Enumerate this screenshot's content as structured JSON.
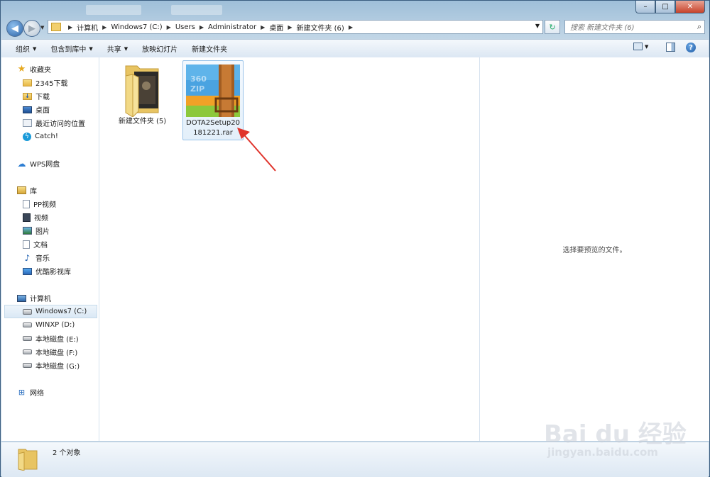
{
  "window": {
    "controls": {
      "minimize": "–",
      "maximize": "□",
      "close": "✕"
    }
  },
  "address": {
    "crumbs": [
      "计算机",
      "Windows7 (C:)",
      "Users",
      "Administrator",
      "桌面",
      "新建文件夹 (6)"
    ],
    "search_placeholder": "搜索 新建文件夹 (6)"
  },
  "toolbar": {
    "organize": "组织",
    "include_library": "包含到库中",
    "share": "共享",
    "slideshow": "放映幻灯片",
    "new_folder": "新建文件夹"
  },
  "sidebar": {
    "favorites": {
      "label": "收藏夹",
      "items": [
        "2345下载",
        "下载",
        "桌面",
        "最近访问的位置",
        "Catch!"
      ]
    },
    "wps": {
      "label": "WPS网盘"
    },
    "libraries": {
      "label": "库",
      "items": [
        "PP视频",
        "视频",
        "图片",
        "文档",
        "音乐",
        "优酷影视库"
      ]
    },
    "computer": {
      "label": "计算机",
      "items": [
        "Windows7 (C:)",
        "WINXP (D:)",
        "本地磁盘 (E:)",
        "本地磁盘 (F:)",
        "本地磁盘 (G:)"
      ]
    },
    "network": {
      "label": "网络"
    }
  },
  "files": [
    {
      "name": "新建文件夹 (5)",
      "type": "folder"
    },
    {
      "name": "DOTA2Setup20181221.rar",
      "type": "rar",
      "badge": "360\nZIP"
    }
  ],
  "preview": {
    "text": "选择要预览的文件。"
  },
  "status": {
    "text": "2 个对象"
  },
  "watermark": {
    "brand": "Bai  du 经验",
    "url": "jingyan.baidu.com"
  },
  "colors": {
    "accent_arrow": "#e0342c",
    "selection": "#99c2e8"
  }
}
